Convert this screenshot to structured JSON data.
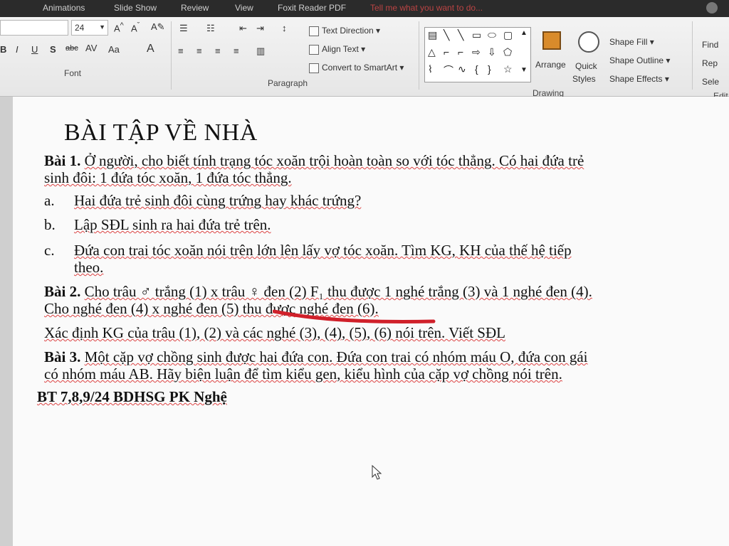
{
  "titlebar": {
    "tabs": [
      "Animations",
      "Slide Show",
      "Review",
      "View",
      "Foxit Reader PDF"
    ],
    "tell_me": "Tell me what you want to do..."
  },
  "ribbon": {
    "font_size": "24",
    "font_group_label": "Font",
    "paragraph_group_label": "Paragraph",
    "drawing_group_label": "Drawing",
    "editing_group_label": "Edit",
    "text_direction": "Text Direction",
    "align_text": "Align Text",
    "convert_smartart": "Convert to SmartArt",
    "arrange": "Arrange",
    "quick_styles_1": "Quick",
    "quick_styles_2": "Styles",
    "shape_fill": "Shape Fill",
    "shape_outline": "Shape Outline",
    "shape_effects": "Shape Effects",
    "find": "Find",
    "replace": "Rep",
    "select": "Sele",
    "font_buttons": [
      "B",
      "I",
      "U",
      "S",
      "abc",
      "AV",
      "Aa",
      "A"
    ]
  },
  "document": {
    "title": "BÀI TẬP VỀ NHÀ",
    "bai1_label": "Bài 1.",
    "bai1_line1": "Ở người, cho biết tính trạng tóc xoăn trội hoàn toàn so với tóc thẳng. Có hai đứa trẻ",
    "bai1_line2": "sinh đôi: 1 đứa tóc xoăn, 1 đứa tóc thẳng.",
    "item_a_marker": "a.",
    "item_a": "Hai đứa trẻ sinh đôi cùng trứng hay khác trứng?",
    "item_b_marker": "b.",
    "item_b": "Lập SĐL sinh ra hai đứa trẻ trên.",
    "item_c_marker": "c.",
    "item_c_line1": "Đứa con trai tóc xoăn nói trên lớn lên lấy vợ tóc xoăn. Tìm KG, KH của thế hệ tiếp",
    "item_c_line2": "theo.",
    "bai2_label": "Bài 2.",
    "bai2_line1": "Cho trâu ♂ trắng (1) x trâu ♀ đen (2) F₁ thu được 1 nghé trắng (3) và 1 nghé đen (4).",
    "bai2_line2": "Cho nghé đen (4) x nghé đen (5) thu được nghé đen (6).",
    "bai2_line3": "Xác định KG của trâu (1), (2) và các nghé (3), (4), (5), (6) nói trên. Viết SĐL",
    "bai3_label": "Bài 3.",
    "bai3_line1": "Một cặp vợ chồng sinh được hai đứa con. Đứa con trai có nhóm máu O, đứa con gái",
    "bai3_line2": "có nhóm máu AB. Hãy biện luận để tìm kiểu gen, kiểu hình của cặp vợ chồng nói trên.",
    "bt_line": "BT 7,8,9/24 BDHSG PK Nghệ"
  },
  "colors": {
    "ribbon_bg": "#e9e9e9",
    "titlebar_bg": "#2b2b2b",
    "page_bg": "#fafafa",
    "spell_underline": "#d44",
    "red_mark": "#d0202a"
  }
}
